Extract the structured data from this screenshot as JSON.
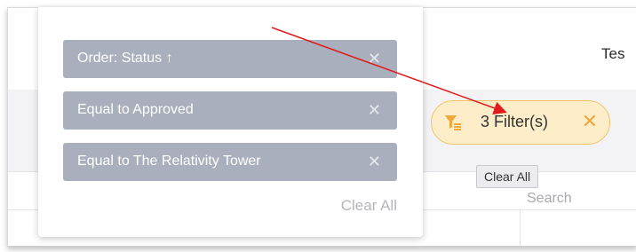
{
  "header": {
    "partial_title": "Tes"
  },
  "filter_pill": {
    "label": "3 Filter(s)",
    "icon": "filter-icon",
    "close_icon": "close-icon"
  },
  "tooltip": {
    "text": "Clear All"
  },
  "table": {
    "search_placeholder": "Search"
  },
  "dropdown": {
    "chips": [
      {
        "label": "Order: Status ↑"
      },
      {
        "label": "Equal to Approved"
      },
      {
        "label": "Equal to The Relativity Tower"
      }
    ],
    "clear_all": "Clear All"
  },
  "colors": {
    "pill_bg": "#fdeec9",
    "pill_border": "#f2c46a",
    "accent_orange": "#f0a83c",
    "chip_bg": "#a9afbc",
    "annotation_arrow": "#e01b1b"
  }
}
